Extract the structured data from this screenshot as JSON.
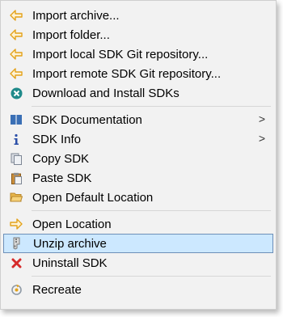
{
  "menu": {
    "group1": [
      {
        "label": "Import archive...",
        "icon": "import-arrow-icon"
      },
      {
        "label": "Import folder...",
        "icon": "import-arrow-icon"
      },
      {
        "label": "Import local SDK Git repository...",
        "icon": "import-arrow-icon"
      },
      {
        "label": "Import remote SDK Git repository...",
        "icon": "import-arrow-icon"
      },
      {
        "label": "Download and Install SDKs",
        "icon": "download-sdk-icon"
      }
    ],
    "group2": [
      {
        "label": "SDK Documentation",
        "icon": "book-icon",
        "submenu": true
      },
      {
        "label": "SDK Info",
        "icon": "info-icon",
        "submenu": true
      },
      {
        "label": "Copy SDK",
        "icon": "copy-icon"
      },
      {
        "label": "Paste SDK",
        "icon": "paste-icon"
      },
      {
        "label": "Open Default Location",
        "icon": "folder-open-icon"
      }
    ],
    "group3": [
      {
        "label": "Open Location",
        "icon": "location-arrow-icon"
      },
      {
        "label": "Unzip archive",
        "icon": "unzip-icon",
        "highlighted": true
      },
      {
        "label": "Uninstall SDK",
        "icon": "uninstall-x-icon"
      }
    ],
    "group4": [
      {
        "label": "Recreate",
        "icon": "recreate-icon"
      }
    ],
    "submenu_arrow": ">"
  },
  "colors": {
    "menu_background": "#f2f2f2",
    "highlight_background": "#cce8ff",
    "highlight_border": "#6d8fb8",
    "import_arrow": "#e3a21a",
    "download_icon": "#1f8a8a",
    "uninstall_icon": "#d62b2b"
  }
}
